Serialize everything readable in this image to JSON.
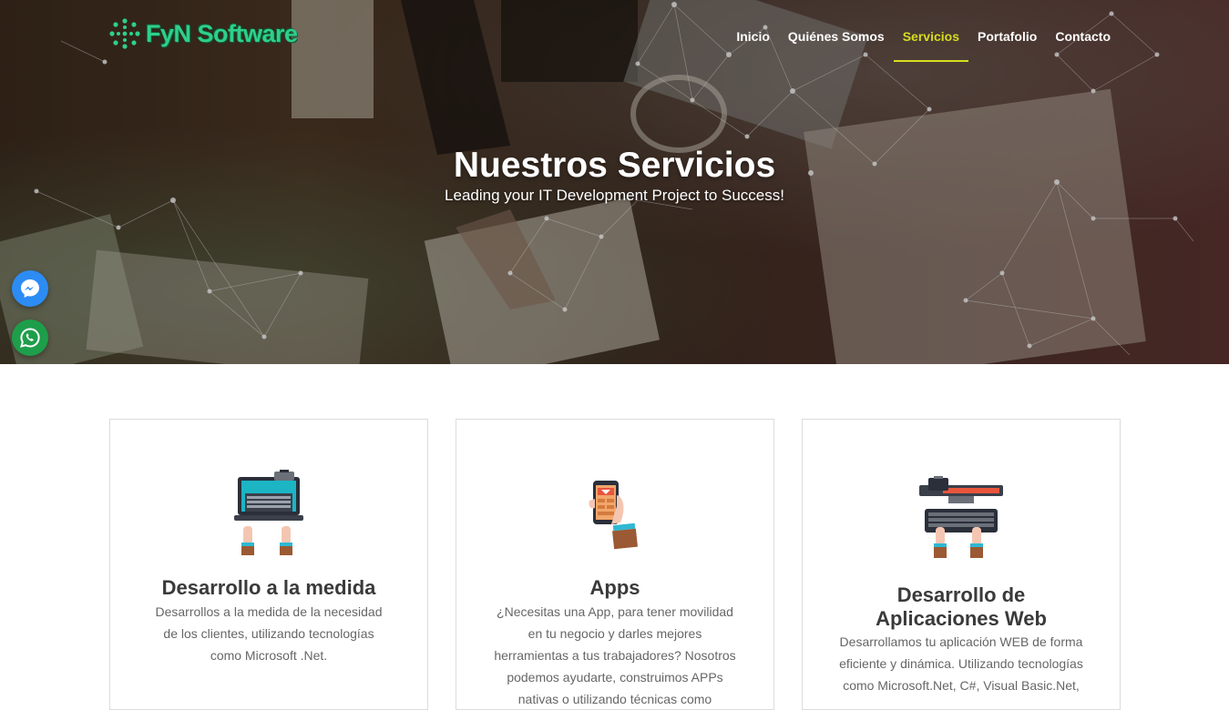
{
  "brand": {
    "name": "FyN Software"
  },
  "nav": {
    "items": [
      {
        "label": "Inicio",
        "active": false
      },
      {
        "label": "Quiénes Somos",
        "active": false
      },
      {
        "label": "Servicios",
        "active": true
      },
      {
        "label": "Portafolio",
        "active": false
      },
      {
        "label": "Contacto",
        "active": false
      }
    ]
  },
  "hero": {
    "title": "Nuestros Servicios",
    "subtitle": "Leading your IT Development Project to Success!"
  },
  "floating": {
    "messenger_icon": "messenger-icon",
    "whatsapp_icon": "whatsapp-icon"
  },
  "services": [
    {
      "icon": "laptop-typing-icon",
      "title": "Desarrollo a la medida",
      "text": "Desarrollos a la medida de la necesidad de los clientes, utilizando tecnologías como Microsoft .Net."
    },
    {
      "icon": "smartphone-app-icon",
      "title": "Apps",
      "text": "¿Necesitas una App, para tener movilidad en tu negocio y darles mejores herramientas a tus trabajadores? Nosotros podemos ayudarte, construimos APPs nativas o utilizando técnicas como"
    },
    {
      "icon": "desktop-keyboard-icon",
      "title": "Desarrollo de Aplicaciones Web",
      "text": "Desarrollamos tu aplicación WEB de forma eficiente y dinámica. Utilizando tecnologías como Microsoft.Net, C#, Visual Basic.Net,"
    }
  ],
  "colors": {
    "accent": "#d7dd1e",
    "brand": "#2fcf8a",
    "messenger": "#2c8cf4",
    "whatsapp": "#1e9e4a"
  }
}
